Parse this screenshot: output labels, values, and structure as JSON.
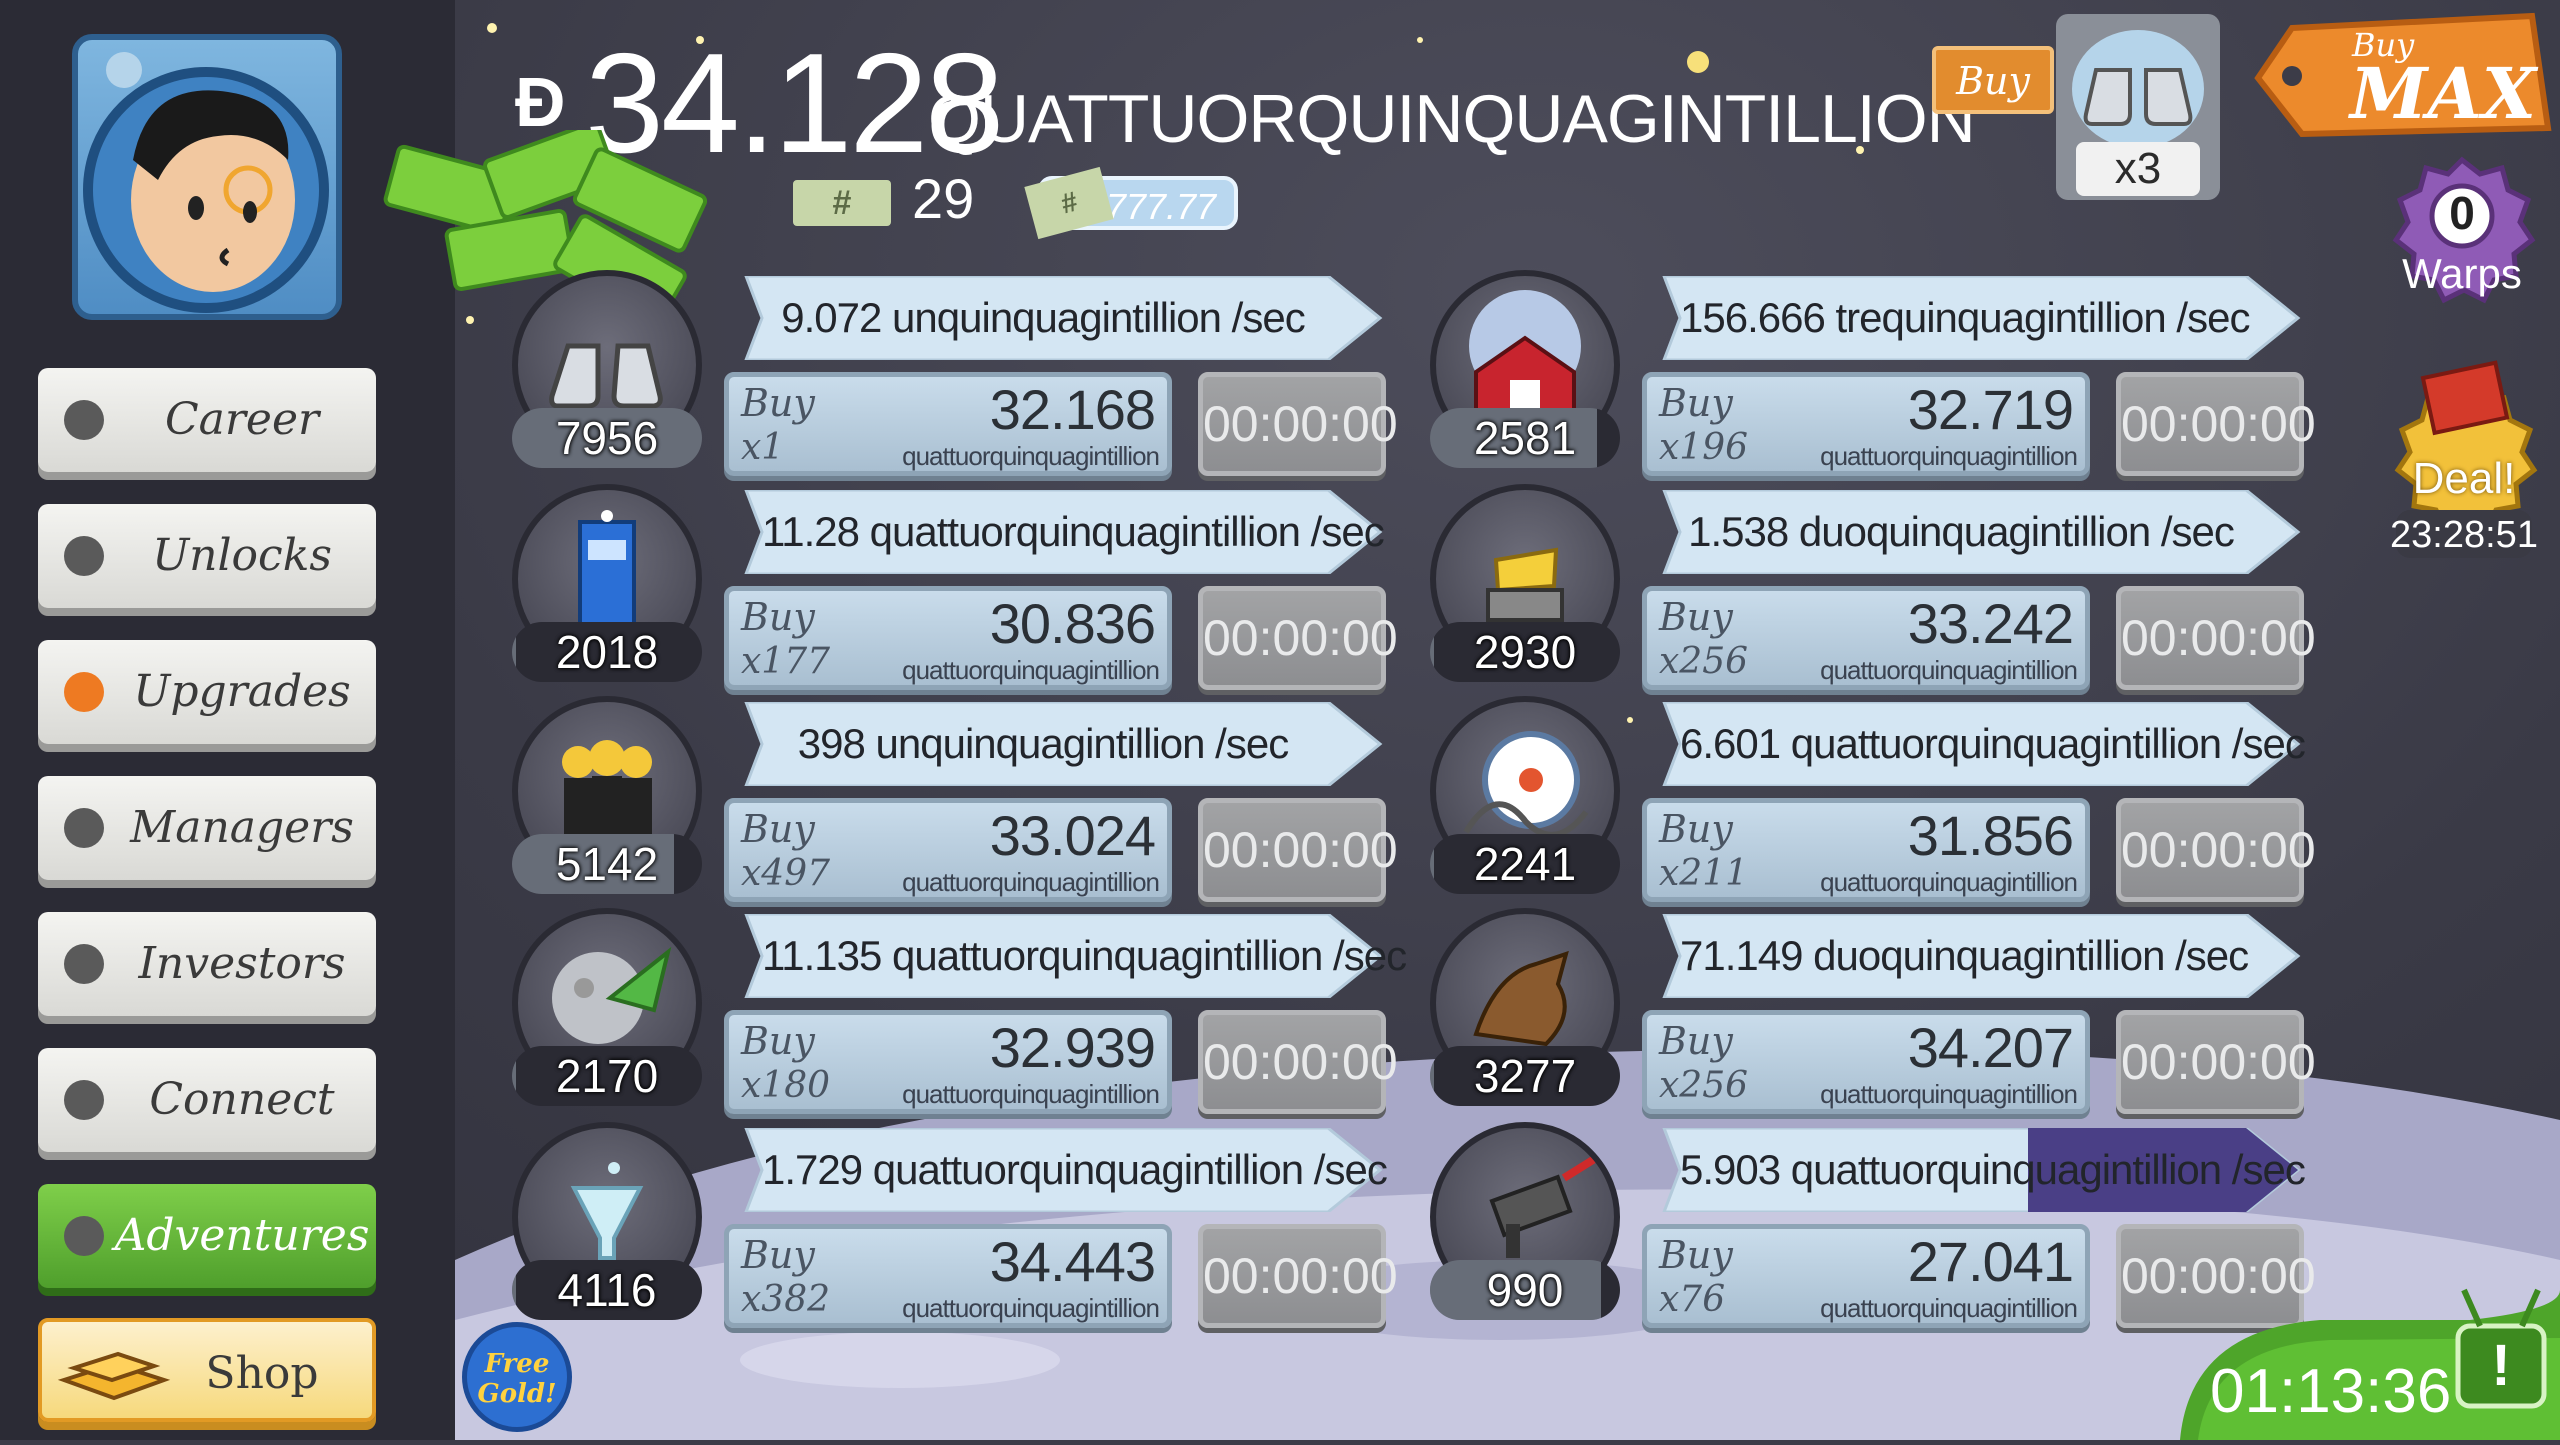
{
  "header": {
    "currency_symbol": "Đ",
    "money_value": "34.128",
    "money_unit": "QUATTUORQUINQUAGINTILLION",
    "angel_icon_label": "#",
    "angel_count": "29",
    "ticket_icon_label": "#",
    "ticket_multiplier": "x777.77"
  },
  "sidebar": {
    "nav": [
      {
        "label": "Career",
        "indicator": "gray"
      },
      {
        "label": "Unlocks",
        "indicator": "gray"
      },
      {
        "label": "Upgrades",
        "indicator": "orange"
      },
      {
        "label": "Managers",
        "indicator": "gray"
      },
      {
        "label": "Investors",
        "indicator": "gray"
      },
      {
        "label": "Connect",
        "indicator": "gray"
      },
      {
        "label": "Adventures",
        "indicator": "gray"
      }
    ],
    "shop_label": "Shop"
  },
  "top_right": {
    "buy_label": "Buy",
    "manager_multiplier": "x3",
    "buy_max_top": "Buy",
    "buy_max_bottom": "MAX",
    "warps_count": "0",
    "warps_label": "Warps",
    "deal_label": "Deal!",
    "deal_timer": "23:28:51"
  },
  "free_gold_label": "Free Gold!",
  "event_timer": "01:13:36",
  "event_icon": "!",
  "businesses": [
    {
      "icon": "moon-boots-icon",
      "owned": "7956",
      "owned_progress": 1.0,
      "rate": "9.072 unquinquagintillion /sec",
      "buy_label": "Buy",
      "buy_qty": "x1",
      "cost": "32.168",
      "cost_unit": "quattuorquinquagintillion",
      "timer": "00:00:00",
      "rate_progress": 0
    },
    {
      "icon": "moon-barn-icon",
      "owned": "2581",
      "owned_progress": 0.88,
      "rate": "156.666 trequinquagintillion /sec",
      "buy_label": "Buy",
      "buy_qty": "x196",
      "cost": "32.719",
      "cost_unit": "quattuorquinquagintillion",
      "timer": "00:00:00",
      "rate_progress": 0
    },
    {
      "icon": "police-box-icon",
      "owned": "2018",
      "owned_progress": 0.02,
      "rate": "11.28 quattuorquinquagintillion /sec",
      "buy_label": "Buy",
      "buy_qty": "x177",
      "cost": "30.836",
      "cost_unit": "quattuorquinquagintillion",
      "timer": "00:00:00",
      "rate_progress": 0
    },
    {
      "icon": "cheese-cart-icon",
      "owned": "2930",
      "owned_progress": 0.02,
      "rate": "1.538 duoquinquagintillion /sec",
      "buy_label": "Buy",
      "buy_qty": "x256",
      "cost": "33.242",
      "cost_unit": "quattuorquinquagintillion",
      "timer": "00:00:00",
      "rate_progress": 0
    },
    {
      "icon": "alien-crew-icon",
      "owned": "5142",
      "owned_progress": 0.85,
      "rate": "398 unquinquagintillion /sec",
      "buy_label": "Buy",
      "buy_qty": "x497",
      "cost": "33.024",
      "cost_unit": "quattuorquinquagintillion",
      "timer": "00:00:00",
      "rate_progress": 0
    },
    {
      "icon": "theme-park-icon",
      "owned": "2241",
      "owned_progress": 0.02,
      "rate": "6.601 quattuorquinquagintillion /sec",
      "buy_label": "Buy",
      "buy_qty": "x211",
      "cost": "31.856",
      "cost_unit": "quattuorquinquagintillion",
      "timer": "00:00:00",
      "rate_progress": 0
    },
    {
      "icon": "moon-rocket-icon",
      "owned": "2170",
      "owned_progress": 0.02,
      "rate": "11.135 quattuorquinquagintillion /sec",
      "buy_label": "Buy",
      "buy_qty": "x180",
      "cost": "32.939",
      "cost_unit": "quattuorquinquagintillion",
      "timer": "00:00:00",
      "rate_progress": 0
    },
    {
      "icon": "werewolf-icon",
      "owned": "3277",
      "owned_progress": 0.02,
      "rate": "71.149 duoquinquagintillion /sec",
      "buy_label": "Buy",
      "buy_qty": "x256",
      "cost": "34.207",
      "cost_unit": "quattuorquinquagintillion",
      "timer": "00:00:00",
      "rate_progress": 0
    },
    {
      "icon": "lunar-drink-icon",
      "owned": "4116",
      "owned_progress": 0.02,
      "rate": "1.729 quattuorquinquagintillion /sec",
      "buy_label": "Buy",
      "buy_qty": "x382",
      "cost": "34.443",
      "cost_unit": "quattuorquinquagintillion",
      "timer": "00:00:00",
      "rate_progress": 0
    },
    {
      "icon": "death-ray-icon",
      "owned": "990",
      "owned_progress": 0.9,
      "rate": "5.903 quattuorquinquagintillion /sec",
      "buy_label": "Buy",
      "buy_qty": "x76",
      "cost": "27.041",
      "cost_unit": "quattuorquinquagintillion",
      "timer": "00:00:00",
      "rate_progress": 0.42
    }
  ],
  "colors": {
    "rate_banner": "#d4e6f3",
    "rate_progress": "#4a3f86",
    "accent_orange": "#e28c2e",
    "accent_green": "#5fb534"
  }
}
